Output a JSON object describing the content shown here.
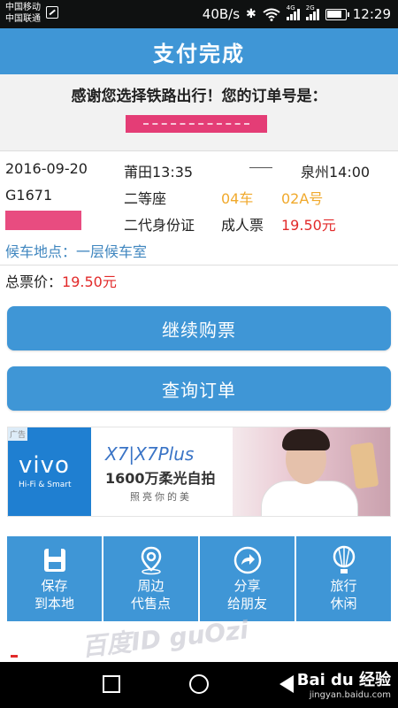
{
  "statusbar": {
    "carrier1": "中国移动",
    "carrier2": "中国联通",
    "speed": "40B/s",
    "bluetooth_glyph": "✱",
    "net1": "4G",
    "net2": "2G",
    "time": "12:29"
  },
  "header": {
    "title": "支付完成"
  },
  "thanks": {
    "message": "感谢您选择铁路出行！您的订单号是："
  },
  "ticket": {
    "date": "2016-09-20",
    "from": "莆田13:35",
    "to": "泉州14:00",
    "train": "G1671",
    "seat_class": "二等座",
    "car": "04车",
    "seat": "02A号",
    "id_type": "二代身份证",
    "ticket_type": "成人票",
    "price": "19.50元",
    "waiting_room": "候车地点：一层候车室"
  },
  "total": {
    "label": "总票价：",
    "value": "19.50元"
  },
  "buttons": {
    "continue": "继续购票",
    "query": "查询订单"
  },
  "ad": {
    "tag": "广告",
    "brand": "vivo",
    "brand_sub": "Hi-Fi & Smart",
    "model": "X7|X7Plus",
    "slogan": "1600万柔光自拍",
    "slogan2": "照亮你的美"
  },
  "quick_actions": [
    {
      "line1": "保存",
      "line2": "到本地",
      "icon": "save-icon"
    },
    {
      "line1": "周边",
      "line2": "代售点",
      "icon": "location-pin-icon"
    },
    {
      "line1": "分享",
      "line2": "给朋友",
      "icon": "share-icon"
    },
    {
      "line1": "旅行",
      "line2": "休闲",
      "icon": "balloon-icon"
    }
  ],
  "watermark": "百度ID guOzi",
  "baidu": {
    "logo": "Bai du 经验",
    "url": "jingyan.baidu.com"
  },
  "colors": {
    "primary": "#3f96d6",
    "price_red": "#e22a2a",
    "car_orange": "#f0a92c",
    "link_blue": "#3f86bf"
  }
}
